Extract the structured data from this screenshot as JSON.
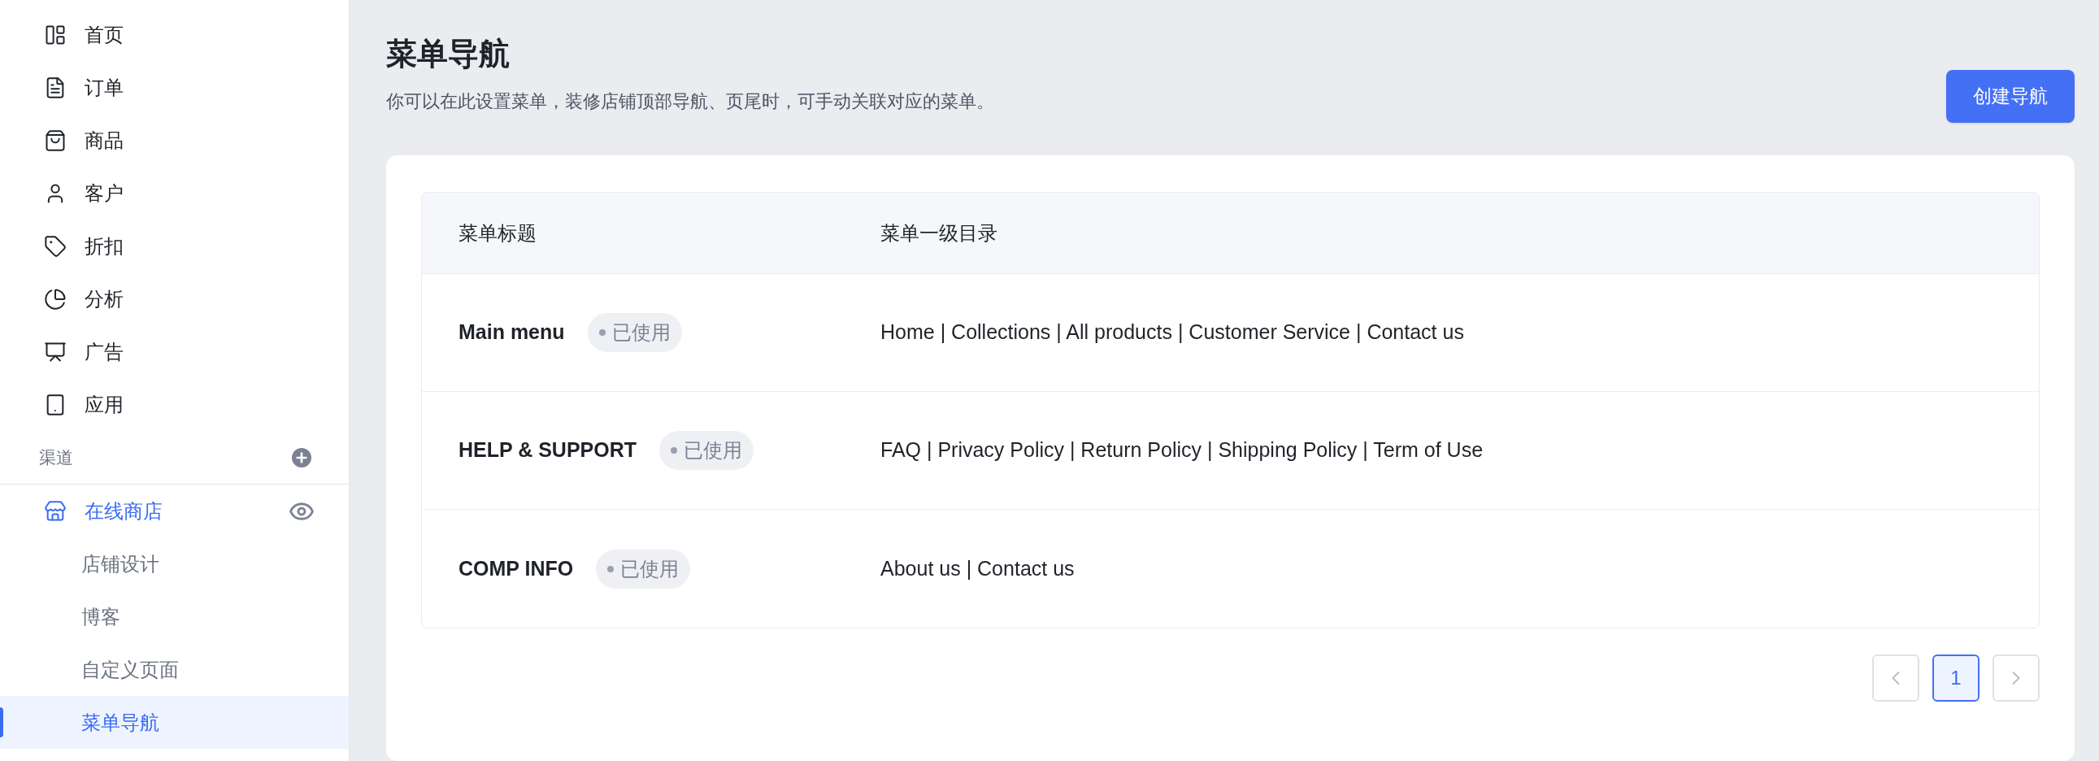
{
  "sidebar": {
    "items": [
      {
        "label": "首页",
        "kind": "home"
      },
      {
        "label": "订单",
        "kind": "orders"
      },
      {
        "label": "商品",
        "kind": "products"
      },
      {
        "label": "客户",
        "kind": "customers"
      },
      {
        "label": "折扣",
        "kind": "discounts"
      },
      {
        "label": "分析",
        "kind": "analytics"
      },
      {
        "label": "广告",
        "kind": "ads"
      },
      {
        "label": "应用",
        "kind": "apps"
      }
    ],
    "section": {
      "label": "渠道"
    },
    "channel": {
      "label": "在线商店",
      "expanded": true,
      "children": [
        {
          "label": "店铺设计",
          "selected": false
        },
        {
          "label": "博客",
          "selected": false
        },
        {
          "label": "自定义页面",
          "selected": false
        },
        {
          "label": "菜单导航",
          "selected": true
        }
      ]
    }
  },
  "header": {
    "title": "菜单导航",
    "subtitle": "你可以在此设置菜单，装修店铺顶部导航、页尾时，可手动关联对应的菜单。",
    "button": "创建导航"
  },
  "table": {
    "columns": [
      "菜单标题",
      "菜单一级目录"
    ],
    "rows": [
      {
        "title": "Main menu",
        "status": "已使用",
        "items": "Home | Collections | All products | Customer Service | Contact us"
      },
      {
        "title": "HELP & SUPPORT",
        "status": "已使用",
        "items": "FAQ | Privacy Policy | Return Policy | Shipping Policy | Term of Use"
      },
      {
        "title": "COMP INFO",
        "status": "已使用",
        "items": "About us | Contact us"
      }
    ]
  },
  "pagination": {
    "prev_disabled": true,
    "next_disabled": true,
    "pages": [
      {
        "label": "1",
        "selected": true
      }
    ]
  }
}
